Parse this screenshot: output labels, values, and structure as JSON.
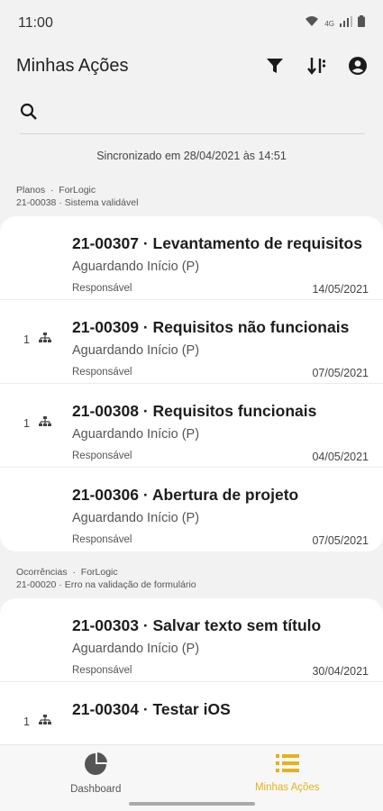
{
  "status_bar": {
    "time": "11:00"
  },
  "header": {
    "title": "Minhas Ações"
  },
  "search": {
    "placeholder": ""
  },
  "sync_text": "Sincronizado em 28/04/2021 às 14:51",
  "groups": [
    {
      "type": "Planos",
      "owner": "ForLogic",
      "code": "21-00038 · Sistema validável",
      "items": [
        {
          "title": "21-00307 · Levantamento de requisitos",
          "status": "Aguardando Início (P)",
          "role": "Responsável",
          "date": "14/05/2021",
          "sub_count": ""
        },
        {
          "title": "21-00309 · Requisitos não funcionais",
          "status": "Aguardando Início (P)",
          "role": "Responsável",
          "date": "07/05/2021",
          "sub_count": "1"
        },
        {
          "title": "21-00308 · Requisitos funcionais",
          "status": "Aguardando Início (P)",
          "role": "Responsável",
          "date": "04/05/2021",
          "sub_count": "1"
        },
        {
          "title": "21-00306 · Abertura de projeto",
          "status": "Aguardando Início (P)",
          "role": "Responsável",
          "date": "07/05/2021",
          "sub_count": ""
        }
      ]
    },
    {
      "type": "Ocorrências",
      "owner": "ForLogic",
      "code": "21-00020 · Erro na validação de formulário",
      "items": [
        {
          "title": "21-00303 · Salvar texto sem título",
          "status": "Aguardando Início (P)",
          "role": "Responsável",
          "date": "30/04/2021",
          "sub_count": ""
        },
        {
          "title": "21-00304 · Testar iOS",
          "status": "",
          "role": "",
          "date": "",
          "sub_count": "1"
        }
      ]
    }
  ],
  "nav": {
    "dashboard": "Dashboard",
    "my_actions": "Minhas Ações"
  },
  "colors": {
    "accent": "#e5b219",
    "card": "#ffffff",
    "background": "#f2f2f2"
  }
}
